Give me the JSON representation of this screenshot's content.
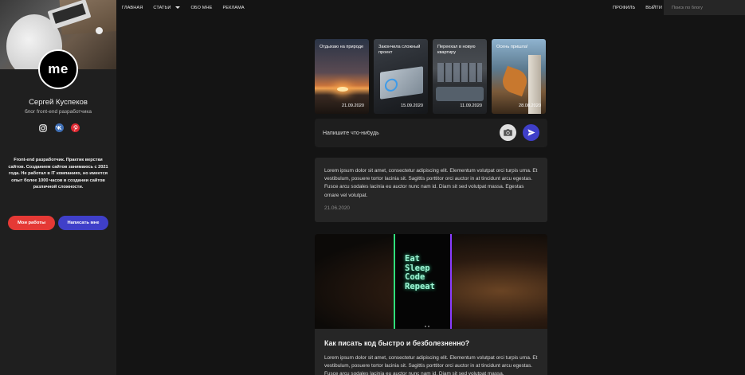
{
  "sidebar": {
    "avatar_text": "me",
    "name": "Сергей Куспеков",
    "subtitle": "блог front-end разработчика",
    "socials": [
      "instagram-icon",
      "vk-icon",
      "pinterest-icon"
    ],
    "bio": "Front-end разработчик. Практик верстки сайтов. Созданием сайтов занимаюсь с 2021 года. Не работал в IT компаниях, но имеется опыт более 1000 часов в создании сайтов различной сложности.",
    "btn_works": "Мои работы",
    "btn_write": "Написать мне"
  },
  "nav": {
    "items": [
      "ГЛАВНАЯ",
      "СТАТЬИ",
      "ОБО МНЕ",
      "РЕКЛАМА"
    ],
    "profile": "ПРОФИЛЬ",
    "logout": "ВЫЙТИ",
    "search_placeholder": "Поиск по блогу"
  },
  "stories": [
    {
      "title": "Отдыхаю на природе",
      "date": "21.09.2020"
    },
    {
      "title": "Закончила сложный проект",
      "date": "15.09.2020"
    },
    {
      "title": "Переехал в новую квартиру",
      "date": "11.09.2020"
    },
    {
      "title": "Осень пришла!",
      "date": "28.08.2020"
    }
  ],
  "composer": {
    "placeholder": "Напишите что-нибудь"
  },
  "posts": [
    {
      "text": "Lorem ipsum dolor sit amet, consectetur adipiscing elit. Elementum volutpat orci turpis urna. Et vestibulum, posuere tortor lacinia sit. Sagittis porttitor orci auctor in at tincidunt arcu egestas. Fusce arcu sodales lacinia eu auctor nunc nam id. Diam sit sed volutpat massa. Egestas ornare vel volutpat.",
      "date": "21.06.2020"
    },
    {
      "image_text": "Eat Sleep Code Repeat",
      "title": "Как писать код быстро и безболезненно?",
      "text": "Lorem ipsum dolor sit amet, consectetur adipiscing elit. Elementum volutpat orci turpis urna. Et vestibulum, posuere tortor lacinia sit. Sagittis porttitor orci auctor in at tincidunt arcu egestas. Fusce arcu sodales lacinia eu auctor nunc nam id. Diam sit sed volutpat massa."
    }
  ],
  "colors": {
    "accent_red": "#e53935",
    "accent_blue": "#3f3fc9"
  }
}
